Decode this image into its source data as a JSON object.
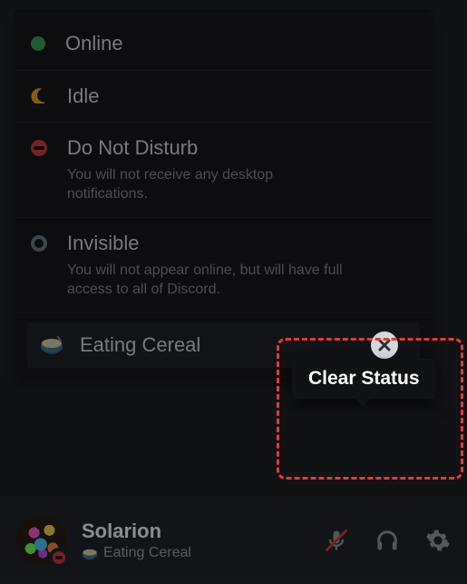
{
  "status_options": {
    "online": {
      "label": "Online"
    },
    "idle": {
      "label": "Idle"
    },
    "dnd": {
      "label": "Do Not Disturb",
      "desc": "You will not receive any desktop notifications."
    },
    "invisible": {
      "label": "Invisible",
      "desc": "You will not appear online, but will have full access to all of Discord."
    }
  },
  "custom_status": {
    "emoji": "bowl-cereal",
    "label": "Eating Cereal"
  },
  "tooltip": {
    "clear_status": "Clear Status"
  },
  "user": {
    "name": "Solarion",
    "status_emoji": "bowl-cereal",
    "status_text": "Eating Cereal",
    "presence": "dnd"
  },
  "icons": {
    "mic_muted": "mic-muted-icon",
    "headphones": "headphones-icon",
    "settings": "gear-icon"
  },
  "colors": {
    "online": "#3ba55d",
    "idle": "#faa81a",
    "dnd": "#d83c3e",
    "offline": "#747f8d",
    "bg_dark": "#18191c",
    "highlight": "#e03a3a"
  }
}
